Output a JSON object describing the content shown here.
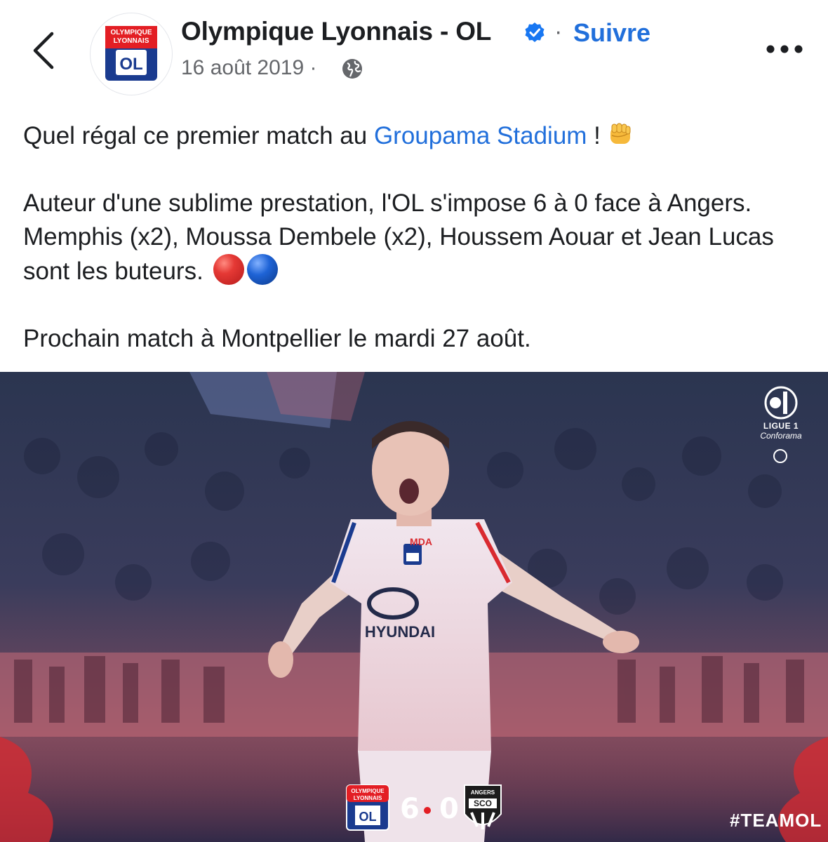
{
  "header": {
    "back_icon": "chevron-left-icon",
    "page_name": "Olympique Lyonnais - OL",
    "verified_icon": "verified-badge-icon",
    "separator": "·",
    "follow_label": "Suivre",
    "date": "16 août 2019 ·",
    "audience_icon": "globe-icon",
    "more_icon": "more-dots-icon",
    "avatar_logo_text": [
      "OLYMPIQUE",
      "LYONNAIS",
      "OL"
    ]
  },
  "post": {
    "line1_before": "Quel régal ce premier match au ",
    "line1_link": "Groupama Stadium",
    "line1_after": " !",
    "line1_emoji": "fist-emoji",
    "para2": "Auteur d'une sublime prestation, l'OL s'impose 6 à 0 face à Angers. Memphis (x2), Moussa Dembele (x2), Houssem Aouar et Jean Lucas sont les buteurs.",
    "para2_emoji": [
      "red-circle-emoji",
      "blue-circle-emoji"
    ],
    "para3": "Prochain match à Montpellier le mardi 27 août."
  },
  "image": {
    "league_logo_line1": "LIGUE 1",
    "league_logo_line2": "Conforama",
    "shirt_sponsor": "HYUNDAI",
    "shirt_logo": "MDA",
    "score_home": "6",
    "score_away": "0",
    "home_badge_text": [
      "OLYMPIQUE",
      "LYONNAIS",
      "OL"
    ],
    "away_badge_text": [
      "ANGERS",
      "SCO"
    ],
    "hashtag": "#TEAMOL"
  },
  "colors": {
    "link": "#216fdb",
    "ol_blue": "#1a3b8f",
    "ol_red": "#e31e24",
    "muted": "#65676b"
  }
}
